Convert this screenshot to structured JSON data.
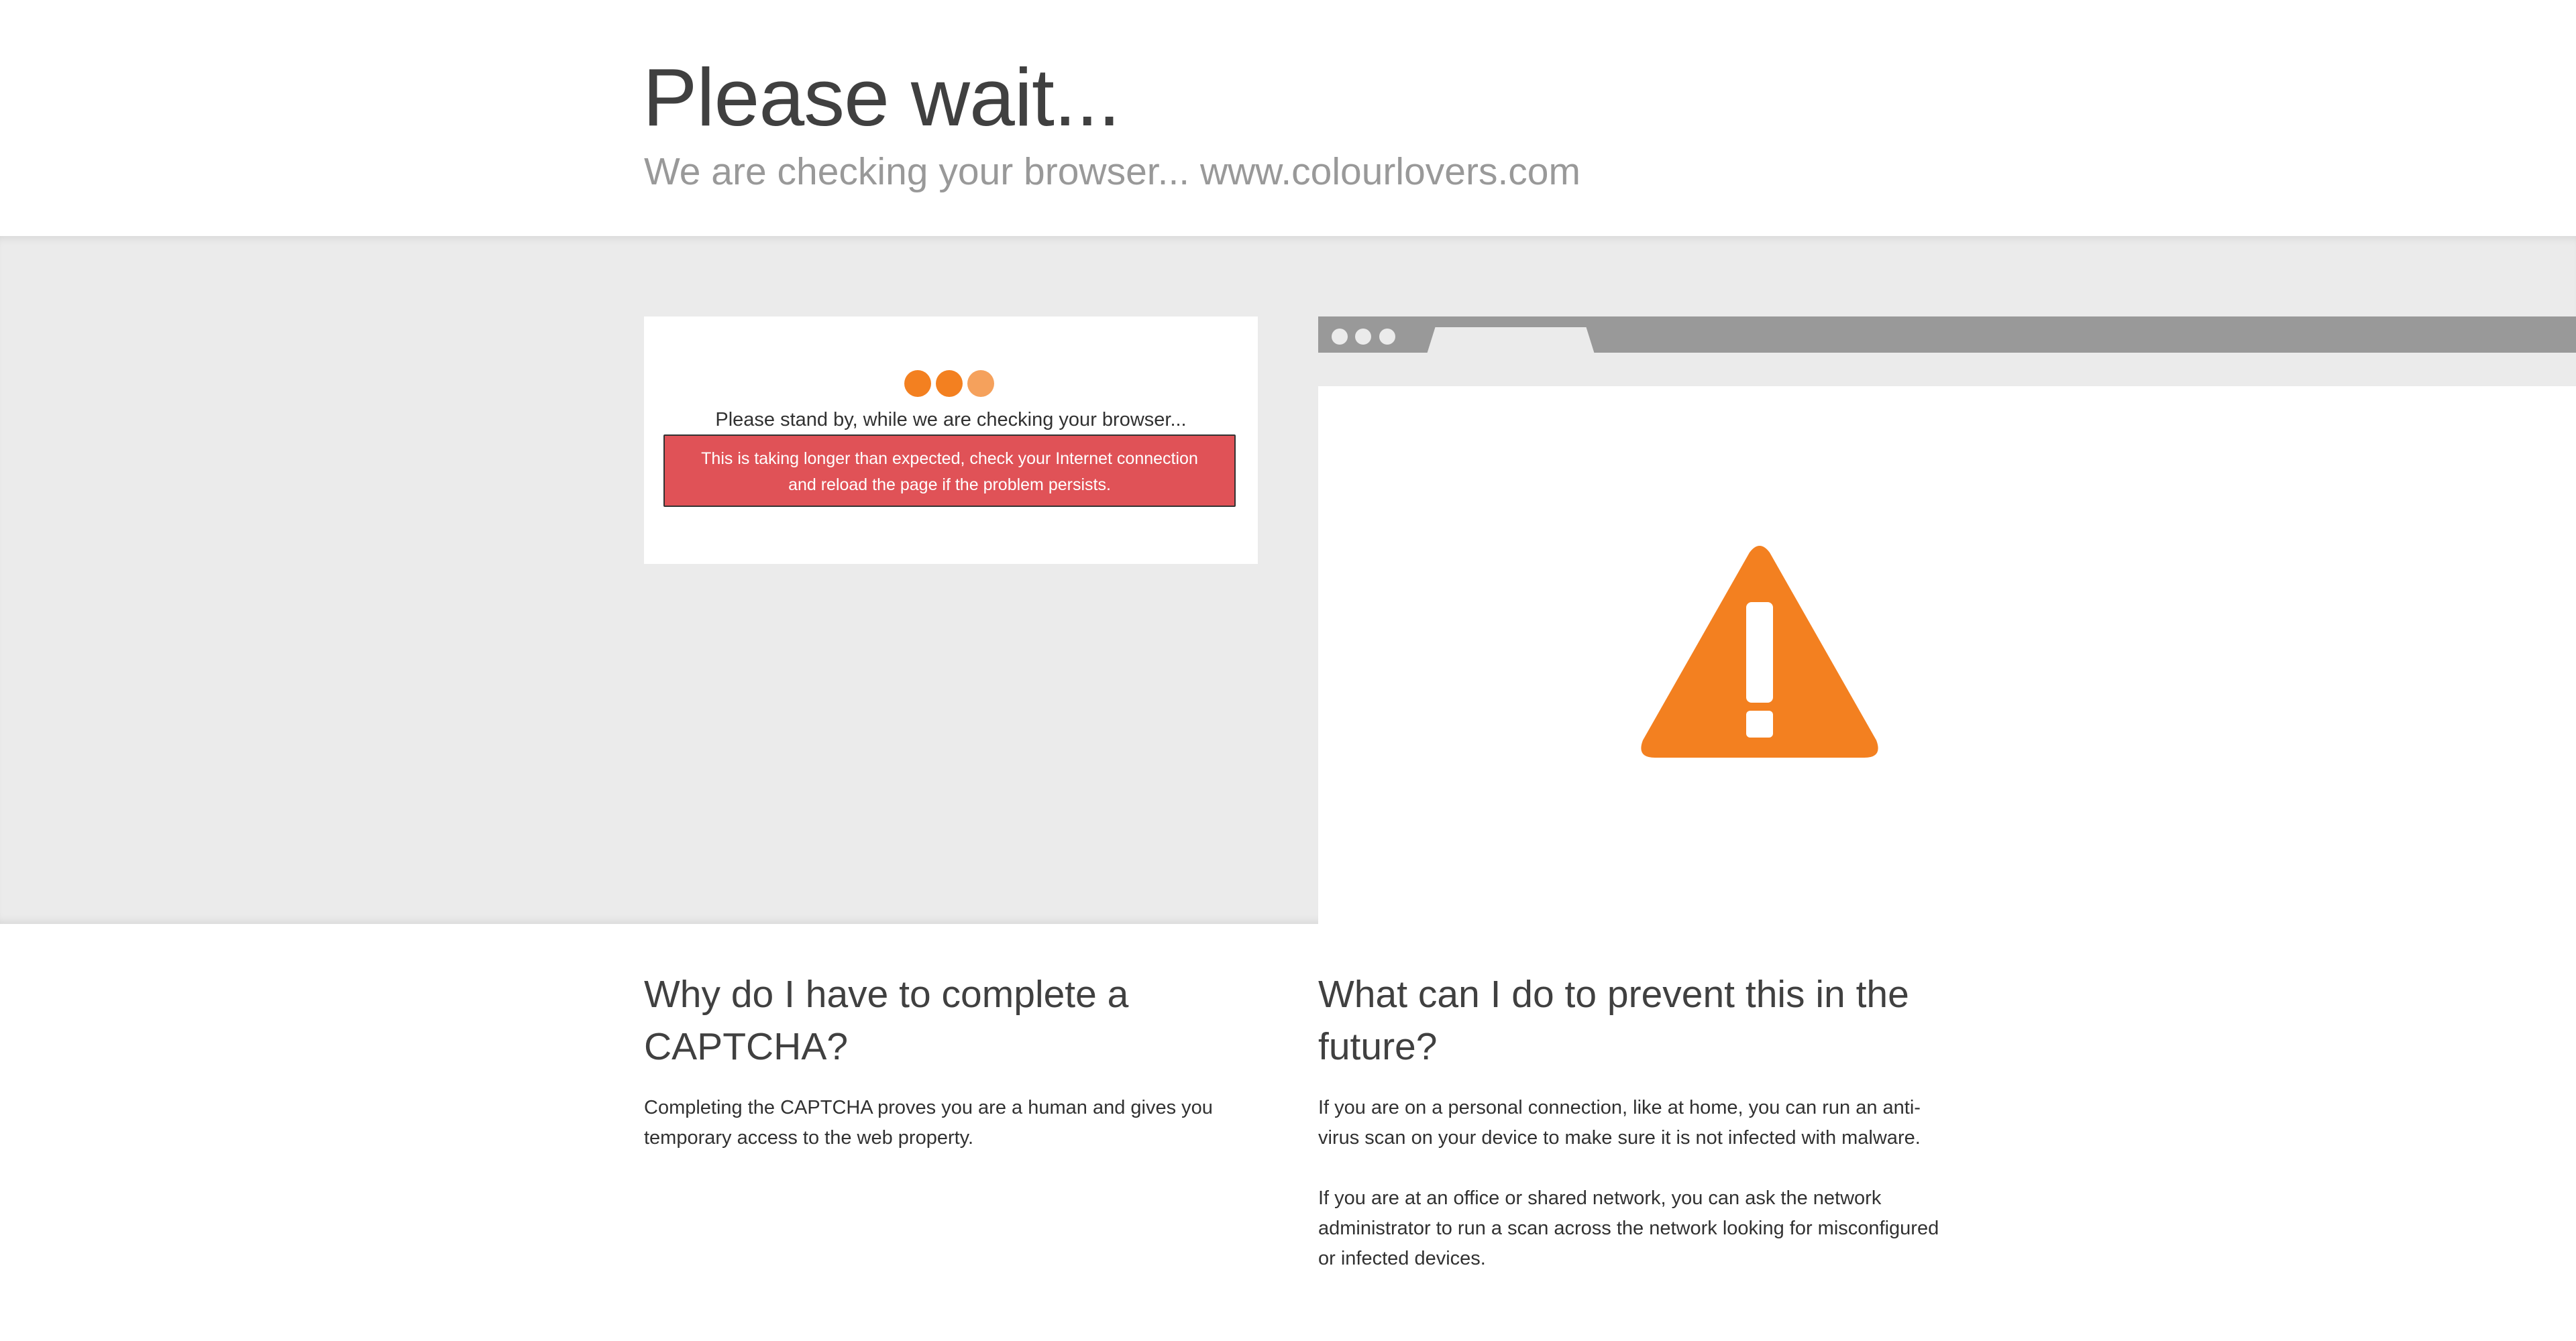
{
  "header": {
    "title": "Please wait...",
    "subtitle": "We are checking your browser... www.colourlovers.com"
  },
  "status_card": {
    "standby_text": "Please stand by, while we are checking your browser...",
    "error_text": "This is taking longer than expected, check your Internet connection and reload the page if the problem persists."
  },
  "illustration": {
    "icon": "warning-icon",
    "accent_color": "#f38020"
  },
  "colors": {
    "accent": "#f38020",
    "error_bg": "#e05257",
    "band_bg": "#ebebeb"
  },
  "sections": {
    "why": {
      "heading": "Why do I have to complete a CAPTCHA?",
      "body": "Completing the CAPTCHA proves you are a human and gives you temporary access to the web property."
    },
    "prevent": {
      "heading": "What can I do to prevent this in the future?",
      "paragraphs": [
        "If you are on a personal connection, like at home, you can run an anti-virus scan on your device to make sure it is not infected with malware.",
        "If you are at an office or shared network, you can ask the network administrator to run a scan across the network looking for misconfigured or infected devices."
      ]
    }
  }
}
